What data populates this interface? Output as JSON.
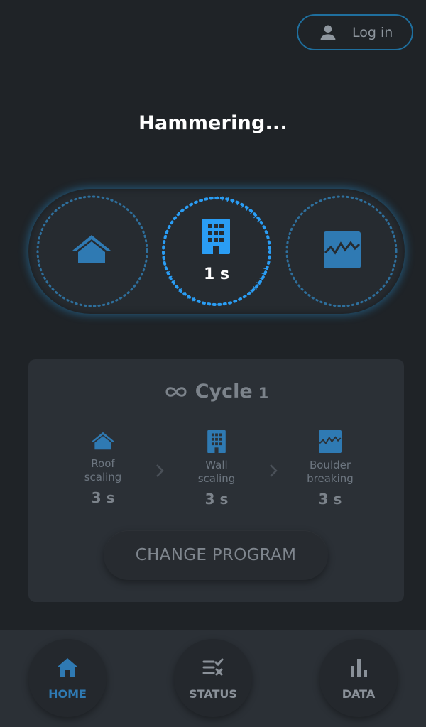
{
  "header": {
    "login_label": "Log in",
    "user_icon": "user-icon"
  },
  "status": {
    "title": "Hammering..."
  },
  "progress": {
    "stages": [
      "roof-scaling-icon",
      "wall-scaling-icon",
      "boulder-breaking-icon"
    ],
    "active_stage_index": 1,
    "timer": "1 s",
    "accent_color": "#2a9df4"
  },
  "program": {
    "cycle_label": "Cycle",
    "cycle_number": "1",
    "cycle_icon": "infinity-icon",
    "steps": [
      {
        "line1": "Roof",
        "line2": "scaling",
        "duration": "3 s",
        "icon": "roof-icon"
      },
      {
        "line1": "Wall",
        "line2": "scaling",
        "duration": "3 s",
        "icon": "building-icon"
      },
      {
        "line1": "Boulder",
        "line2": "breaking",
        "duration": "3 s",
        "icon": "boulder-icon"
      }
    ],
    "change_button_label": "CHANGE PROGRAM"
  },
  "nav": {
    "items": [
      {
        "label": "HOME",
        "icon": "home-icon",
        "active": true
      },
      {
        "label": "STATUS",
        "icon": "status-list-icon",
        "active": false
      },
      {
        "label": "DATA",
        "icon": "bar-chart-icon",
        "active": false
      }
    ],
    "active_color": "#2f7ab3"
  }
}
